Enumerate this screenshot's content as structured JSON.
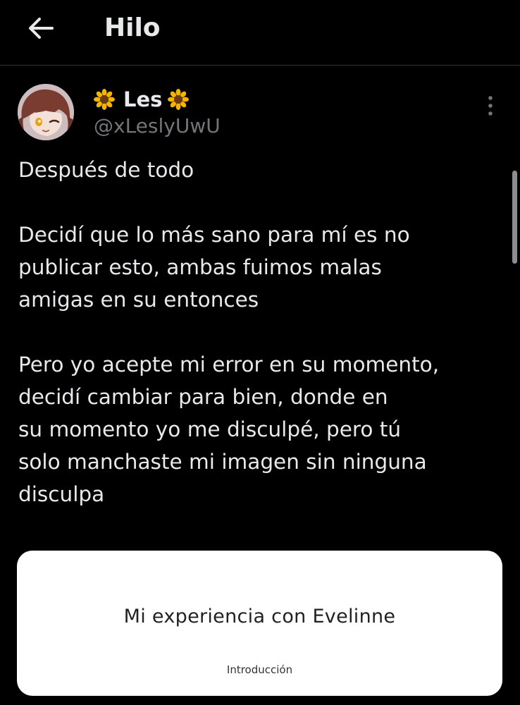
{
  "header": {
    "title": "Hilo",
    "back_icon": "arrow-left-icon"
  },
  "tweet": {
    "author": {
      "display_name": "Les",
      "name_emoji": "sunflower-icon",
      "handle": "@xLeslyUwU",
      "avatar": "anime-avatar-image"
    },
    "more_icon": "more-vertical-icon",
    "paragraphs": [
      {
        "lines": [
          "Después de todo"
        ]
      },
      {
        "lines": [
          "Decidí que lo más sano para mí es no",
          "publicar esto, ambas fuimos malas",
          "amigas en su entonces"
        ]
      },
      {
        "lines": [
          "Pero yo acepte mi error en su momento,",
          "decidí cambiar para bien, donde en",
          "su momento yo me disculpé, pero tú",
          "solo manchaste mi imagen sin ninguna",
          "disculpa"
        ]
      }
    ],
    "card": {
      "title": "Mi experiencia con Evelinne",
      "subtitle": "Introducción"
    }
  },
  "colors": {
    "background": "#000000",
    "text_primary": "#e7e9ea",
    "text_secondary": "#71767b",
    "divider": "#2f3336",
    "card_background": "#ffffff"
  }
}
